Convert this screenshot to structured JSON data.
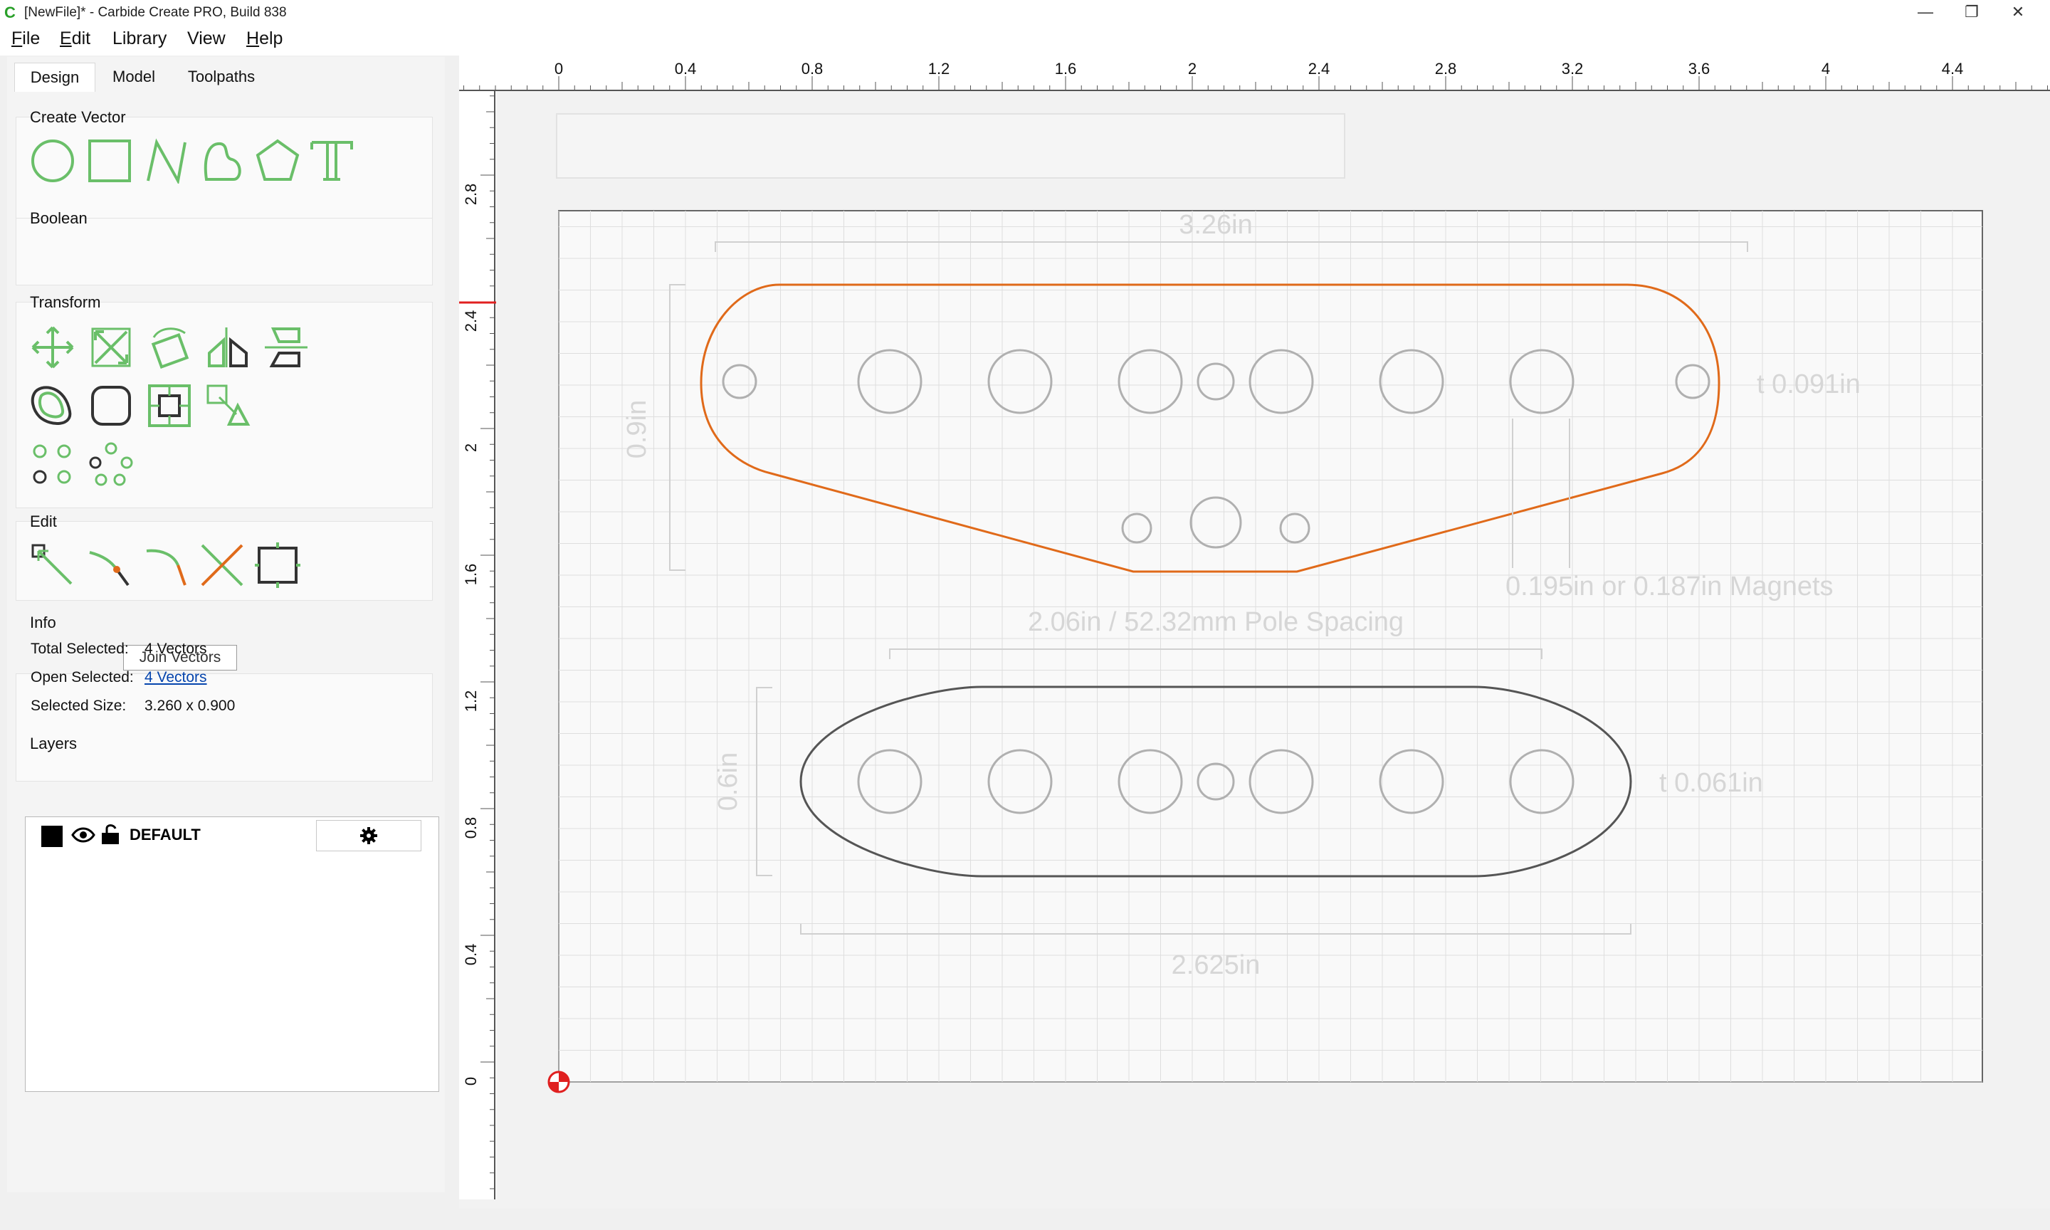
{
  "window": {
    "title": "[NewFile]* - Carbide Create PRO, Build 838",
    "minimize_glyph": "—",
    "maximize_glyph": "❐",
    "close_glyph": "✕"
  },
  "menu": [
    {
      "accel": "F",
      "rest": "ile"
    },
    {
      "accel": "E",
      "rest": "dit"
    },
    {
      "accel": "",
      "rest": "Library"
    },
    {
      "accel": "",
      "rest": "View"
    },
    {
      "accel": "H",
      "rest": "elp"
    }
  ],
  "tabs": [
    "Design",
    "Model",
    "Toolpaths"
  ],
  "sections": {
    "create_vector": "Create Vector",
    "boolean": "Boolean",
    "transform": "Transform",
    "edit": "Edit",
    "info": "Info",
    "layers": "Layers"
  },
  "icons": {
    "create_vector": [
      "circle-icon",
      "rectangle-icon",
      "polyline-icon",
      "curve-icon",
      "polygon-icon",
      "text-icon"
    ],
    "transform": [
      "move-icon",
      "scale-icon",
      "rotate-icon",
      "mirror-icon",
      "align-icon",
      "offset-icon",
      "fillet-icon",
      "center-icon",
      "array-icon",
      "grid-array-icon",
      "circular-array-icon"
    ],
    "edit": [
      "node-edit-icon",
      "join-vectors-icon",
      "smooth-icon",
      "trim-icon",
      "bounding-box-icon"
    ]
  },
  "tooltip": "Join Vectors",
  "info": {
    "total_selected_label": "Total Selected:",
    "total_selected_value": "4 Vectors",
    "open_selected_label": "Open Selected:",
    "open_selected_value": "4 Vectors",
    "selected_size_label": "Selected Size:",
    "selected_size_value": "3.260 x 0.900"
  },
  "layers": [
    {
      "name": "DEFAULT",
      "color": "#000000",
      "visible": true,
      "locked": false
    }
  ],
  "rulers": {
    "top": [
      "0",
      "0.4",
      "0.8",
      "1.2",
      "1.6",
      "2",
      "2.4",
      "2.8",
      "3.2",
      "3.6",
      "4",
      "4.4"
    ],
    "left": [
      "2.8",
      "2.4",
      "2",
      "1.6",
      "1.2",
      "0.8",
      "0.4",
      "0"
    ]
  },
  "annotations": {
    "top_width": "3.26in",
    "top_height": "0.9in",
    "top_thickness": "t 0.091in",
    "magnets": "0.195in or 0.187in Magnets",
    "pole_spacing": "2.06in / 52.32mm Pole Spacing",
    "bottom_height": "0.6in",
    "bottom_thickness": "t 0.061in",
    "bottom_width": "2.625in"
  },
  "colors": {
    "accent_green": "#6abf69",
    "selection_orange": "#e06a1a",
    "origin_red": "#e02020",
    "link_blue": "#0645ad"
  }
}
